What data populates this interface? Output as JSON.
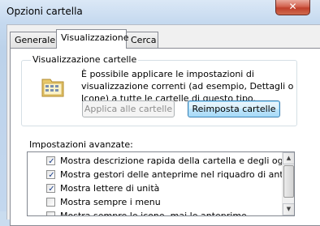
{
  "window": {
    "title": "Opzioni cartella",
    "close_symbol": "✕"
  },
  "tabs": [
    {
      "label": "Generale",
      "active": false
    },
    {
      "label": "Visualizzazione",
      "active": true
    },
    {
      "label": "Cerca",
      "active": false
    }
  ],
  "folder_views": {
    "legend": "Visualizzazione cartelle",
    "description": "È possibile applicare le impostazioni di visualizzazione correnti (ad esempio, Dettagli o Icone) a tutte le cartelle di questo tipo.",
    "apply_button": "Applica alle cartelle",
    "reset_button": "Reimposta cartelle",
    "icon": "folder-view-icon"
  },
  "advanced": {
    "label": "Impostazioni avanzate:",
    "items": [
      {
        "text": "Mostra descrizione rapida della cartella e degli oggetti del",
        "checked": true
      },
      {
        "text": "Mostra gestori delle anteprime nel riquadro di anteprima",
        "checked": true
      },
      {
        "text": "Mostra lettere di unità",
        "checked": true
      },
      {
        "text": "Mostra sempre i menu",
        "checked": false
      },
      {
        "text": "Mostra sempre le icone, mai le anteprime",
        "checked": false
      }
    ]
  },
  "colors": {
    "accent": "#3c7fb1",
    "check": "#1c3f8a",
    "close": "#c0402b"
  }
}
